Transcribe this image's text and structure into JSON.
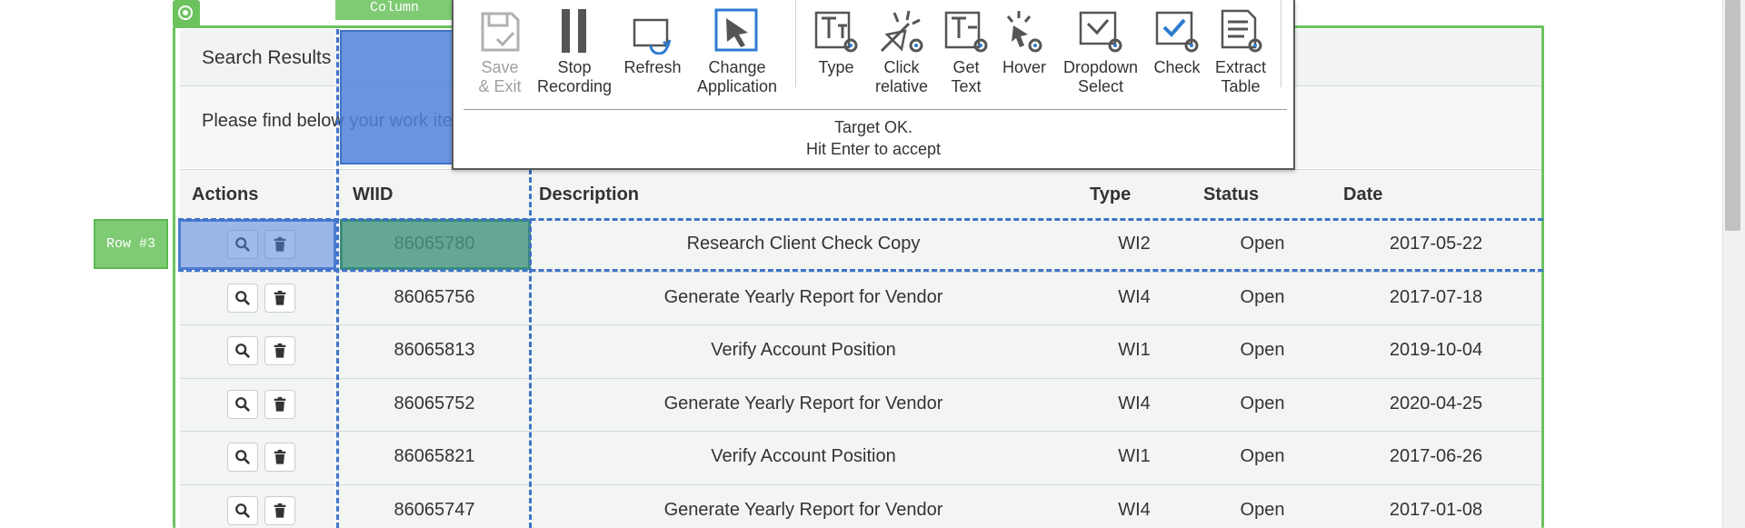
{
  "panel": {
    "title": "Search Results",
    "message": "Please find below your work items"
  },
  "table": {
    "headers": [
      "Actions",
      "WIID",
      "Description",
      "Type",
      "Status",
      "Date"
    ],
    "rows": [
      {
        "wiid": "86065780",
        "description": "Research Client Check Copy",
        "type": "WI2",
        "status": "Open",
        "date": "2017-05-22"
      },
      {
        "wiid": "86065756",
        "description": "Generate Yearly Report for Vendor",
        "type": "WI4",
        "status": "Open",
        "date": "2017-07-18"
      },
      {
        "wiid": "86065813",
        "description": "Verify Account Position",
        "type": "WI1",
        "status": "Open",
        "date": "2019-10-04"
      },
      {
        "wiid": "86065752",
        "description": "Generate Yearly Report for Vendor",
        "type": "WI4",
        "status": "Open",
        "date": "2020-04-25"
      },
      {
        "wiid": "86065821",
        "description": "Verify Account Position",
        "type": "WI1",
        "status": "Open",
        "date": "2017-06-26"
      },
      {
        "wiid": "86065747",
        "description": "Generate Yearly Report for Vendor",
        "type": "WI4",
        "status": "Open",
        "date": "2017-01-08"
      }
    ],
    "row_actions": [
      "search-icon",
      "trash-icon"
    ]
  },
  "overlay": {
    "row_label": "Row #3",
    "column_label": "Column",
    "colors": {
      "frame": "#6cc35e",
      "selection": "#4c7ed0",
      "cell": "#3c8c78"
    }
  },
  "toolbar": {
    "tools": [
      {
        "id": "save-exit",
        "line1": "Save",
        "line2": "& Exit",
        "enabled": false,
        "icon": "save-icon"
      },
      {
        "id": "stop-recording",
        "line1": "Stop",
        "line2": "Recording",
        "enabled": true,
        "icon": "pause-icon"
      },
      {
        "id": "refresh",
        "line1": "Refresh",
        "line2": "",
        "enabled": true,
        "icon": "refresh-icon"
      },
      {
        "id": "change-application",
        "line1": "Change",
        "line2": "Application",
        "enabled": true,
        "icon": "cursor-icon"
      },
      {
        "id": "type",
        "line1": "Type",
        "line2": "",
        "enabled": true,
        "icon": "type-icon"
      },
      {
        "id": "click-relative",
        "line1": "Click",
        "line2": "relative",
        "enabled": true,
        "icon": "click-icon"
      },
      {
        "id": "get-text",
        "line1": "Get",
        "line2": "Text",
        "enabled": true,
        "icon": "get-text-icon"
      },
      {
        "id": "hover",
        "line1": "Hover",
        "line2": "",
        "enabled": true,
        "icon": "hover-icon"
      },
      {
        "id": "dropdown-select",
        "line1": "Dropdown",
        "line2": "Select",
        "enabled": true,
        "icon": "dropdown-icon"
      },
      {
        "id": "check",
        "line1": "Check",
        "line2": "",
        "enabled": true,
        "icon": "check-icon"
      },
      {
        "id": "extract-table",
        "line1": "Extract",
        "line2": "Table",
        "enabled": true,
        "icon": "table-icon"
      }
    ],
    "status_line1": "Target OK.",
    "status_line2": "Hit Enter to accept"
  }
}
